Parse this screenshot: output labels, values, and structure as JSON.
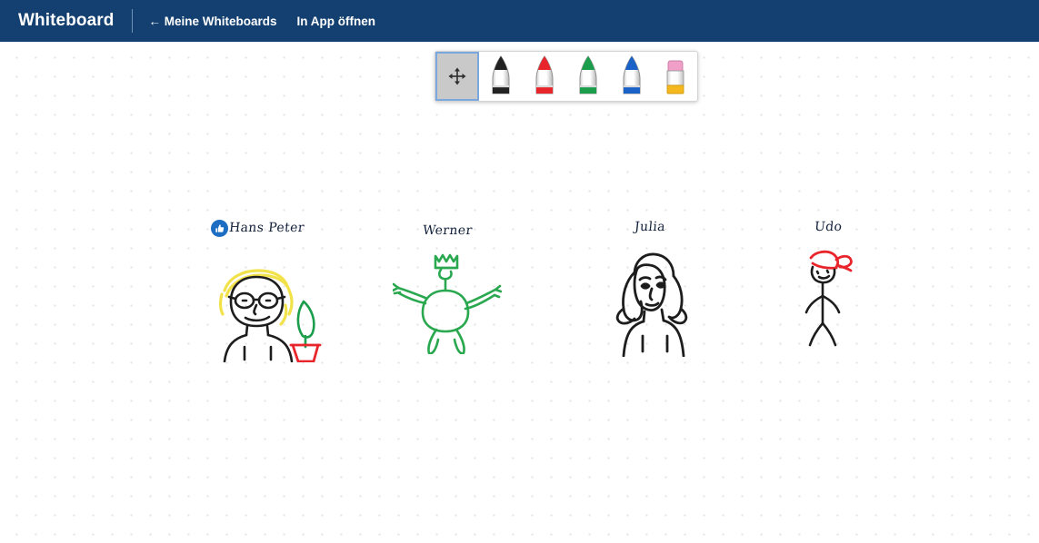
{
  "header": {
    "title": "Whiteboard",
    "links": [
      {
        "id": "my-whiteboards",
        "label": "← Meine Whiteboards"
      },
      {
        "id": "open-in-app",
        "label": "In App öffnen"
      }
    ],
    "background_color": "#134070",
    "text_color": "#ffffff"
  },
  "toolbar": {
    "tools": [
      {
        "id": "move",
        "icon": "move-arrows-icon",
        "label": "Verschieben",
        "color": "#3a3a3a",
        "selected": true
      },
      {
        "id": "pen-black",
        "icon": "pen-icon",
        "label": "Stift Schwarz",
        "color": "#222222",
        "selected": false
      },
      {
        "id": "pen-red",
        "icon": "pen-icon",
        "label": "Stift Rot",
        "color": "#e8252a",
        "selected": false
      },
      {
        "id": "pen-green",
        "icon": "pen-icon",
        "label": "Stift Grün",
        "color": "#1a9e4b",
        "selected": false
      },
      {
        "id": "pen-blue",
        "icon": "pen-icon",
        "label": "Stift Blau",
        "color": "#1a62c8",
        "selected": false
      },
      {
        "id": "eraser",
        "icon": "eraser-icon",
        "label": "Radiergummi",
        "color": "#f0a0c8",
        "selected": false
      }
    ],
    "selected_tool": "move"
  },
  "canvas": {
    "background_color": "#ffffff",
    "dot_color": "#e3e3e6",
    "grid_spacing": 21,
    "drawings": [
      {
        "id": "hans-peter",
        "name": "Hans Peter",
        "reaction": {
          "type": "thumbs-up",
          "color": "#1b6ec2"
        },
        "ink_colors": [
          "#1d1d1d",
          "#f2e24a",
          "#1a9e4b",
          "#e8252a"
        ],
        "description": "Gesicht mit Brille und blonden Haaren, daneben eine Pflanze im Topf"
      },
      {
        "id": "werner",
        "name": "Werner",
        "reaction": null,
        "ink_colors": [
          "#2aa84f"
        ],
        "description": "Grüne Figur mit Krone, ausgestreckten Armen und Beinen"
      },
      {
        "id": "julia",
        "name": "Julia",
        "reaction": null,
        "ink_colors": [
          "#1d1d1d"
        ],
        "description": "Portrait mit langen welligen Haaren und Schultern"
      },
      {
        "id": "udo",
        "name": "Udo",
        "reaction": null,
        "ink_colors": [
          "#1d1d1d",
          "#e8252a"
        ],
        "description": "Strichmännchen mit rotem Kopftuch"
      }
    ]
  }
}
